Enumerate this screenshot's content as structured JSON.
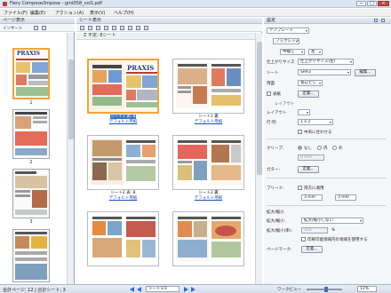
{
  "window": {
    "title": "Fiery Compose/Impose - grid358_vol1.pdf",
    "minimize": "─",
    "maximize": "□",
    "close": "✕"
  },
  "menubar": {
    "items": [
      "ファイル(F)",
      "編集(E)",
      "アクション(A)",
      "表示(V)",
      "ヘルプ(H)"
    ]
  },
  "left_panel": {
    "title": "ページ表示",
    "toolbar_label": "インサート",
    "page_numbers": [
      "1",
      "2",
      "3"
    ]
  },
  "center_panel": {
    "title": "シート表示",
    "section": "Z 不定: 8シート",
    "sheets": [
      {
        "label": "シート1 表: 8",
        "sublabel": "デフォルト用紙",
        "selected": true
      },
      {
        "label": "シート1 裏",
        "sublabel": "デフォルト用紙",
        "selected": false
      },
      {
        "label": "シート2 表: 8",
        "sublabel": "デフォルト用紙",
        "selected": false
      },
      {
        "label": "シート2 裏",
        "sublabel": "デフォルト用紙",
        "selected": false
      },
      {
        "label": "",
        "sublabel": "",
        "selected": false
      },
      {
        "label": "",
        "sublabel": "",
        "selected": false
      }
    ]
  },
  "right_panel": {
    "title": "設定",
    "template_label": "テンプレート",
    "booklet": "ブックレット",
    "binding": "中綴じ",
    "binding_side": "左",
    "finish_size_label": "仕上がりサイズ",
    "finish_size_value": "仕上がりサイズ(左)",
    "sheet_label": "シート",
    "sheet_value": "SRA3",
    "edit_button": "編集...",
    "print_side_label": "両面",
    "print_side_value": "長辺とじ",
    "surface_label": "表紙",
    "define_button": "定義...",
    "layout_label": "レイアウト",
    "layout_value": "1 x 2",
    "rows_label": "行:列",
    "center_checkbox": "中央に合わせる",
    "creep_label": "クリープ:",
    "creep_options": [
      "なし",
      "内",
      "外"
    ],
    "creep_value": "0 mm",
    "gutter_label": "ガター:",
    "gutter_button": "定義...",
    "bleed_label": "ブリード:",
    "bleed_checkbox": "両方に適用",
    "bleed_x": "3 mm",
    "bleed_y": "3 mm",
    "scale_section": "拡大/縮小",
    "scale_label": "拡大/縮小:",
    "scale_value": "拡大/縮小しない",
    "scale_pct_label": "拡大/縮小(率):",
    "scale_pct": "100",
    "scale_unit": "%",
    "fit_checkbox": "印刷可能領域内の領域を使用する",
    "page_mark_label": "ページマーク:",
    "page_mark_button": "定義..."
  },
  "statusbar": {
    "left_text": "合計ページ: 12 | 合計シート: 3",
    "sheet_select": "シート1/3",
    "viewer_label": "ワークビュー",
    "zoom": "12%"
  },
  "colors": {
    "selection": "#f3a43a",
    "link": "#1a4fb5",
    "nav_arrow": "#2d6fd6",
    "panel_header": "#d5deea",
    "close_button": "#c9463d"
  }
}
